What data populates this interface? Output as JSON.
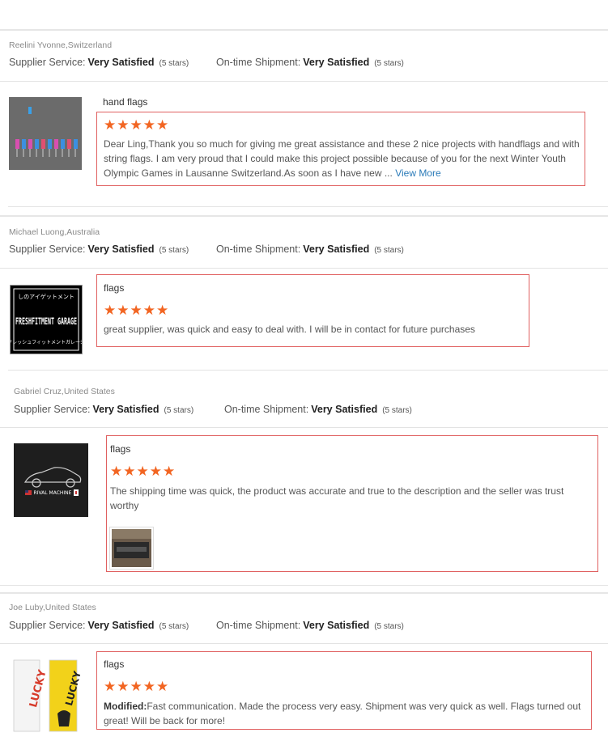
{
  "reviews": [
    {
      "reviewer": "Reelini Yvonne,Switzerland",
      "supplier_label": "Supplier Service:",
      "supplier_value": "Very Satisfied",
      "supplier_stars": "(5 stars)",
      "shipment_label": "On-time Shipment:",
      "shipment_value": "Very Satisfied",
      "shipment_stars": "(5 stars)",
      "product": "hand flags",
      "rating": "★★★★★",
      "text": "Dear Ling,Thank you so much for giving me great assistance and these 2 nice projects with handflags and with string flags. I am very proud that I could make this project possible because of you for the next Winter Youth Olympic Games in Lausanne Switzerland.As soon as I have new ... ",
      "view_more": "View More",
      "image": "hand-flags-photo"
    },
    {
      "reviewer": "Michael Luong,Australia",
      "supplier_label": "Supplier Service:",
      "supplier_value": "Very Satisfied",
      "supplier_stars": "(5 stars)",
      "shipment_label": "On-time Shipment:",
      "shipment_value": "Very Satisfied",
      "shipment_stars": "(5 stars)",
      "product": "flags",
      "rating": "★★★★★",
      "text": "great supplier, was quick and easy to deal with. I will be in contact for future purchases",
      "image": "garage-flag-photo",
      "image_text_top": "しのアイゲットメント",
      "image_text_main": "FRESHFITMENT GARAGE",
      "image_text_bottom": "フレッシュフィットメントガレージ"
    },
    {
      "reviewer": "Gabriel Cruz,United States",
      "supplier_label": "Supplier Service:",
      "supplier_value": "Very Satisfied",
      "supplier_stars": "(5 stars)",
      "shipment_label": "On-time Shipment:",
      "shipment_value": "Very Satisfied",
      "shipment_stars": "(5 stars)",
      "product": "flags",
      "rating": "★★★★★",
      "text": "The shipping time was quick, the product was accurate and true to the description and the seller was trust worthy",
      "image": "car-flag-photo",
      "image_text": "RIVAL MACHINE",
      "attachment": "review-attachment-photo"
    },
    {
      "reviewer": "Joe Luby,United States",
      "supplier_label": "Supplier Service:",
      "supplier_value": "Very Satisfied",
      "supplier_stars": "(5 stars)",
      "shipment_label": "On-time Shipment:",
      "shipment_value": "Very Satisfied",
      "shipment_stars": "(5 stars)",
      "product": "flags",
      "rating": "★★★★★",
      "modified_label": "Modified:",
      "text": "Fast communication. Made the process very easy. Shipment was very quick as well. Flags turned out great! Will be back for more!",
      "image": "banner-flags-photo",
      "image_text_left": "LUCKY",
      "image_text_right": "LUCKY"
    }
  ],
  "colors": {
    "star": "#f26522",
    "box_border": "#e06060",
    "link": "#2a7ab8"
  }
}
